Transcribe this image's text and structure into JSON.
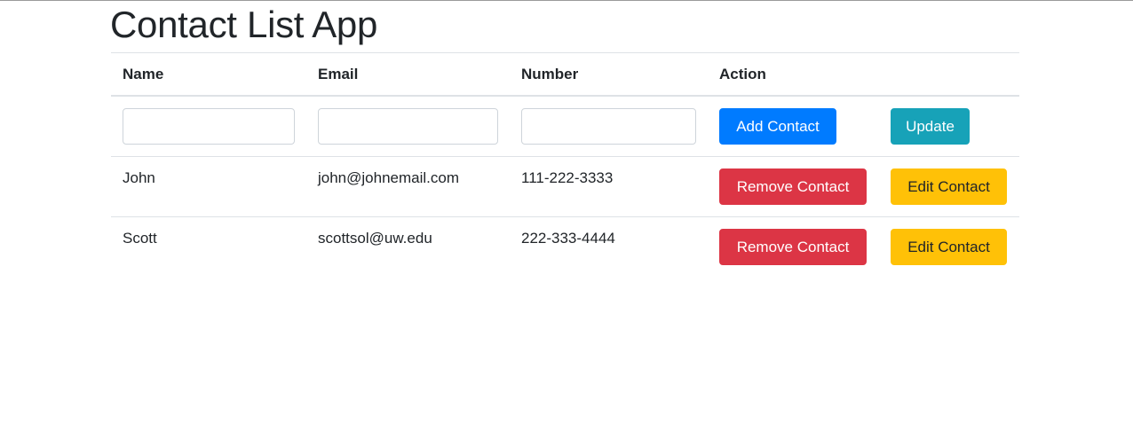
{
  "app": {
    "title": "Contact List App"
  },
  "table": {
    "columns": [
      "Name",
      "Email",
      "Number",
      "Action",
      ""
    ],
    "inputs": {
      "name_value": "",
      "email_value": "",
      "number_value": ""
    },
    "buttons": {
      "add_label": "Add Contact",
      "update_label": "Update",
      "remove_label": "Remove Contact",
      "edit_label": "Edit Contact"
    },
    "rows": [
      {
        "name": "John",
        "email": "john@johnemail.com",
        "number": "111-222-3333"
      },
      {
        "name": "Scott",
        "email": "scottsol@uw.edu",
        "number": "222-333-4444"
      }
    ]
  },
  "colors": {
    "primary": "#007bff",
    "info": "#17a2b8",
    "danger": "#dc3545",
    "warning": "#ffc107",
    "text": "#212529",
    "border": "#dee2e6"
  }
}
